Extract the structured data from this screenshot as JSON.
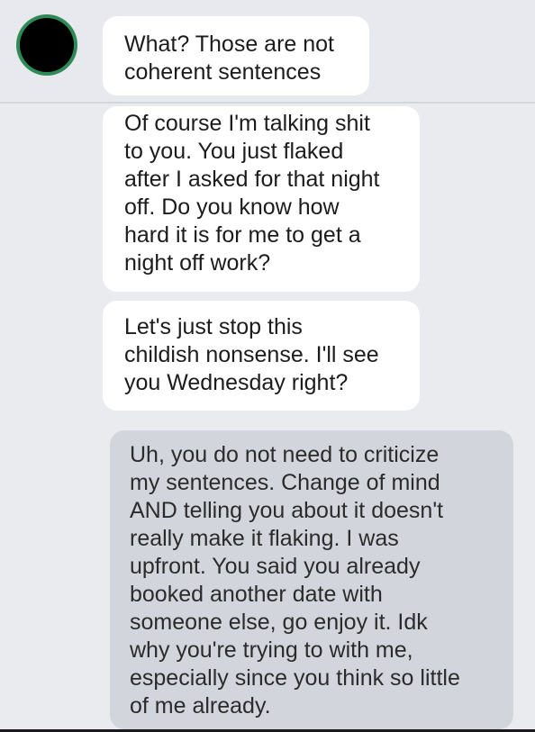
{
  "conversation": {
    "messages": [
      {
        "direction": "incoming",
        "text": "What? Those are not\ncoherent sentences"
      },
      {
        "direction": "incoming",
        "text": "Of course I'm talking shit\nto you. You just flaked\nafter I asked for that night\noff. Do you know how\nhard it is for me to get a\nnight off work?"
      },
      {
        "direction": "incoming",
        "text": "Let's just stop this\nchildish nonsense. I'll see\nyou Wednesday  right?"
      },
      {
        "direction": "outgoing",
        "text": "Uh, you do not need to criticize\nmy sentences. Change of mind\nAND telling you about it doesn't\nreally make it flaking. I was\nupfront. You said you already\nbooked another date with\nsomeone else, go enjoy it. Idk\nwhy you're trying to with me,\nespecially since you think so little\nof me already."
      }
    ]
  },
  "colors": {
    "background": "#e9ebee",
    "incoming_bubble": "#ffffff",
    "outgoing_bubble": "#d2d6dc",
    "avatar_ring": "#2e8b57",
    "avatar_fill": "#000000"
  },
  "icons": {
    "avatar": "contact-avatar"
  }
}
